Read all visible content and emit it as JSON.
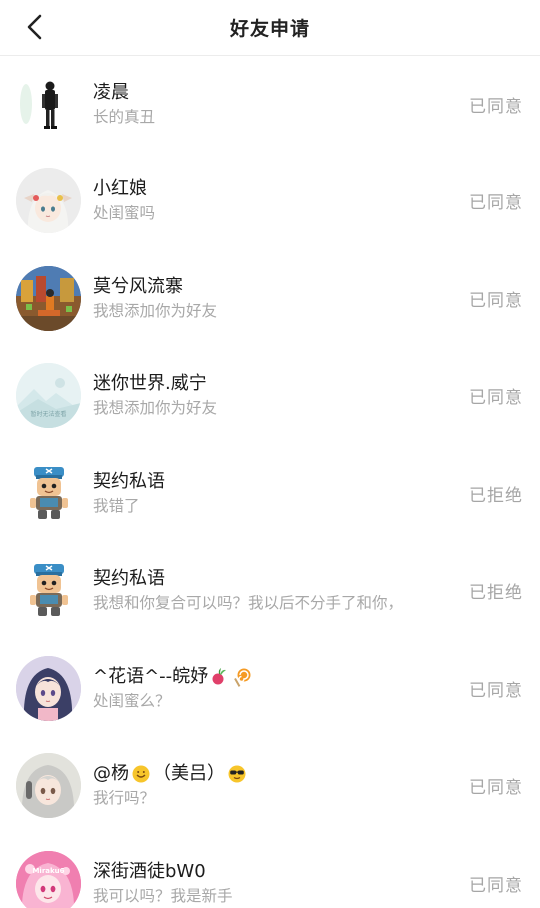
{
  "header": {
    "title": "好友申请",
    "back_icon": "chevron-left-icon"
  },
  "requests": [
    {
      "name": "凌晨",
      "message": "长的真丑",
      "status": "已同意",
      "avatar": "figure-standing"
    },
    {
      "name": "小红娘",
      "message": "处闺蜜吗",
      "status": "已同意",
      "avatar": "anime-girl-white-hair"
    },
    {
      "name": "莫兮风流寨",
      "message": "我想添加你为好友",
      "status": "已同意",
      "avatar": "game-scene"
    },
    {
      "name": "迷你世界.威宁",
      "message": "我想添加你为好友",
      "status": "已同意",
      "avatar": "placeholder-mountain",
      "avatar_caption": "暂时无法查看"
    },
    {
      "name": "契约私语",
      "message": "我错了",
      "status": "已拒绝",
      "avatar": "game-character"
    },
    {
      "name": "契约私语",
      "message": "我想和你复合可以吗？我以后不分手了和你，",
      "status": "已拒绝",
      "avatar": "game-character"
    },
    {
      "name": "^花语^--皖妤",
      "message": "处闺蜜么？",
      "status": "已同意",
      "avatar": "anime-girl-dark-hair",
      "name_emojis": [
        "radish-emoji",
        "lollipop-emoji"
      ]
    },
    {
      "name": "@杨",
      "name_suffix": "（美吕）",
      "message": "我行吗？",
      "status": "已同意",
      "avatar": "anime-girl-gray-hair",
      "name_emojis": [
        "smile-emoji",
        "sunglasses-emoji"
      ]
    },
    {
      "name": "深街酒徒bW0",
      "message": "我可以吗？我是新手",
      "status": "已同意",
      "avatar": "pink-anime",
      "avatar_caption": "Miraku6"
    }
  ],
  "colors": {
    "status": "#a6a6a6",
    "message": "#a8a8a8",
    "name": "#1c1c1c"
  }
}
